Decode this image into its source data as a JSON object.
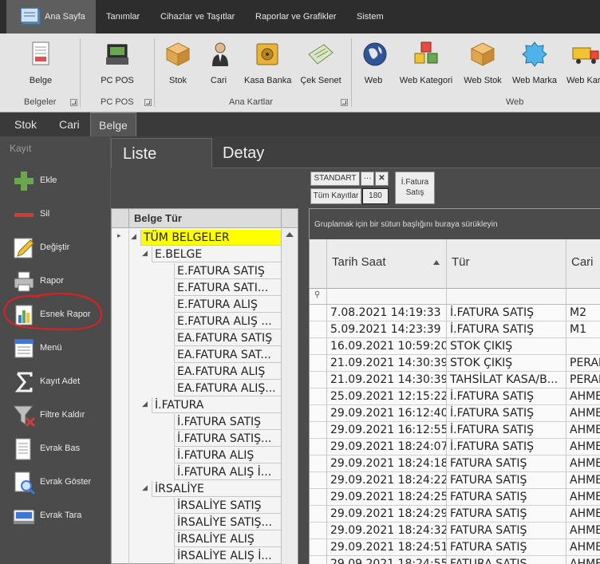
{
  "ribbon_tabs": [
    "Ana Sayfa",
    "Tanımlar",
    "Cihazlar ve Taşıtlar",
    "Raporlar ve Grafikler",
    "Sistem"
  ],
  "ribbon": {
    "belge": "Belge",
    "pc_pos": "PC POS",
    "stok": "Stok",
    "cari": "Cari",
    "kasa_banka": "Kasa Banka",
    "cek_senet": "Çek Senet",
    "web": "Web",
    "web_kategori": "Web Kategori",
    "web_stok": "Web Stok",
    "web_marka": "Web Marka",
    "web_kargo": "Web Kar",
    "groups": {
      "belgeler": "Belgeler",
      "pc_pos": "PC POS",
      "ana_kartlar": "Ana Kartlar",
      "web": "Web"
    }
  },
  "module_tabs": [
    "Stok",
    "Cari",
    "Belge"
  ],
  "left_panel": {
    "title": "Kayıt",
    "items": [
      {
        "label": "Ekle",
        "icon": "plus-icon"
      },
      {
        "label": "Sil",
        "icon": "minus-icon"
      },
      {
        "label": "Değiştir",
        "icon": "pencil-icon"
      },
      {
        "label": "Rapor",
        "icon": "printer-icon"
      },
      {
        "label": "Esnek Rapor",
        "icon": "bar-chart-icon"
      },
      {
        "label": "Menü",
        "icon": "menu-icon"
      },
      {
        "label": "Kayıt Adet",
        "icon": "sigma-icon"
      },
      {
        "label": "Filtre Kaldır",
        "icon": "filter-remove-icon"
      },
      {
        "label": "Evrak Bas",
        "icon": "document-print-icon"
      },
      {
        "label": "Evrak Göster",
        "icon": "document-search-icon"
      },
      {
        "label": "Evrak Tara",
        "icon": "scanner-icon"
      }
    ]
  },
  "view_tabs": {
    "liste": "Liste",
    "detay": "Detay"
  },
  "chips": {
    "standart": "STANDART",
    "ellipsis": "···",
    "close": "✕",
    "tum_kayitlar": "Tüm Kayıtlar",
    "count": "180",
    "ifatura": "İ.Fatura\nSatış"
  },
  "tree": {
    "header": "Belge Tür",
    "rows": [
      {
        "label": "TÜM BELGELER",
        "level": 0,
        "expander": true,
        "selected": true
      },
      {
        "label": "E.BELGE",
        "level": 1,
        "expander": true
      },
      {
        "label": "E.FATURA SATIŞ",
        "level": 2
      },
      {
        "label": "E.FATURA SATI...",
        "level": 2
      },
      {
        "label": "E.FATURA ALIŞ",
        "level": 2
      },
      {
        "label": "E.FATURA ALIŞ ...",
        "level": 2
      },
      {
        "label": "EA.FATURA SATIŞ",
        "level": 2
      },
      {
        "label": "EA.FATURA SAT...",
        "level": 2
      },
      {
        "label": "EA.FATURA ALIŞ",
        "level": 2
      },
      {
        "label": "EA.FATURA ALIŞ...",
        "level": 2
      },
      {
        "label": "İ.FATURA",
        "level": 1,
        "expander": true
      },
      {
        "label": "İ.FATURA SATIŞ",
        "level": 2
      },
      {
        "label": "İ.FATURA SATIŞ...",
        "level": 2
      },
      {
        "label": "İ.FATURA ALIŞ",
        "level": 2
      },
      {
        "label": "İ.FATURA ALIŞ İ...",
        "level": 2
      },
      {
        "label": "İRSALİYE",
        "level": 1,
        "expander": true
      },
      {
        "label": "İRSALİYE SATIŞ",
        "level": 2
      },
      {
        "label": "İRSALİYE SATIŞ...",
        "level": 2
      },
      {
        "label": "İRSALİYE ALIŞ",
        "level": 2
      },
      {
        "label": "İRSALİYE ALIŞ İ...",
        "level": 2
      }
    ]
  },
  "grid": {
    "group_hint": "Gruplamak için bir sütun başlığını buraya sürükleyin",
    "columns": [
      "Tarih Saat",
      "Tür",
      "Cari"
    ],
    "rows": [
      [
        "7.08.2021 14:19:33",
        "İ.FATURA SATIŞ",
        "M2"
      ],
      [
        "5.09.2021 14:23:39",
        "İ.FATURA SATIŞ",
        "M1"
      ],
      [
        "16.09.2021 10:59:20",
        "STOK ÇIKIŞ",
        ""
      ],
      [
        "21.09.2021 14:30:39",
        "STOK ÇIKIŞ",
        "PERAK"
      ],
      [
        "21.09.2021 14:30:39",
        "TAHSİLAT KASA/B...",
        "PERAK"
      ],
      [
        "25.09.2021 12:15:22",
        "İ.FATURA SATIŞ",
        "AHME"
      ],
      [
        "29.09.2021 16:12:40",
        "İ.FATURA SATIŞ",
        "AHME"
      ],
      [
        "29.09.2021 16:12:55",
        "İ.FATURA SATIŞ",
        "AHME"
      ],
      [
        "29.09.2021 18:24:07",
        "İ.FATURA SATIŞ",
        "AHME"
      ],
      [
        "29.09.2021 18:24:18",
        "FATURA SATIŞ",
        "AHME"
      ],
      [
        "29.09.2021 18:24:22",
        "FATURA SATIŞ",
        "AHME"
      ],
      [
        "29.09.2021 18:24:25",
        "FATURA SATIŞ",
        "AHME"
      ],
      [
        "29.09.2021 18:24:29",
        "FATURA SATIŞ",
        "AHME"
      ],
      [
        "29.09.2021 18:24:32",
        "FATURA SATIŞ",
        "AHME"
      ],
      [
        "29.09.2021 18:24:51",
        "FATURA SATIŞ",
        "AHME"
      ],
      [
        "29.09.2021 18:24:55",
        "FATURA SATIŞ",
        "AHME"
      ]
    ]
  },
  "colors": {
    "selected_tree_row": "#ffff00",
    "annotation": "#e02020"
  }
}
